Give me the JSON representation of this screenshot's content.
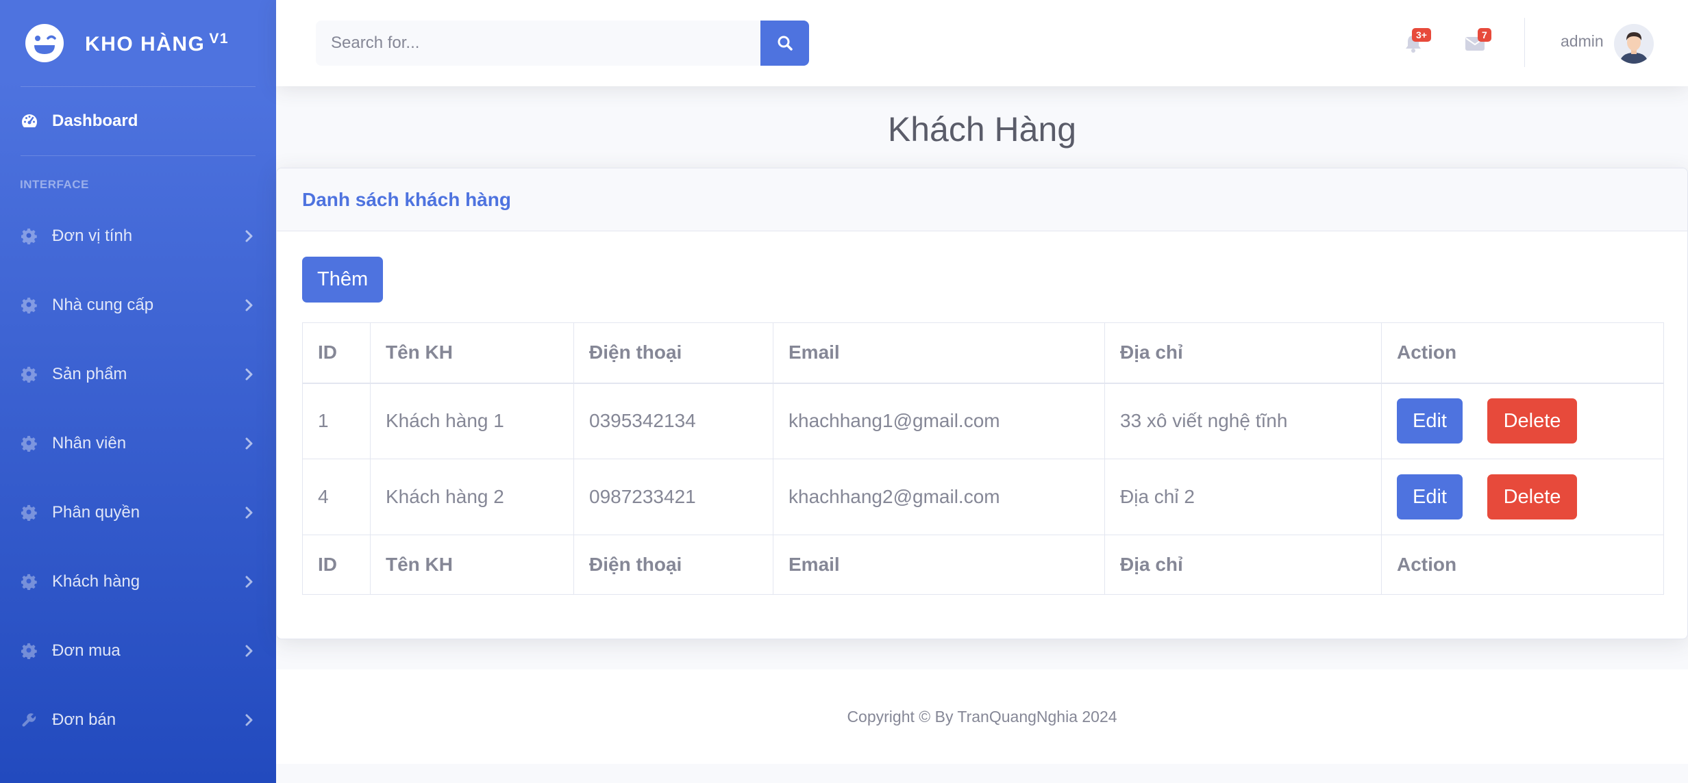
{
  "brand": {
    "name": "KHO HÀNG",
    "version": "V1"
  },
  "sidebar": {
    "dashboard": "Dashboard",
    "heading": "INTERFACE",
    "items": [
      {
        "label": "Đơn vị tính",
        "icon": "cog-icon"
      },
      {
        "label": "Nhà cung cấp",
        "icon": "cog-icon"
      },
      {
        "label": "Sản phẩm",
        "icon": "cog-icon"
      },
      {
        "label": "Nhân viên",
        "icon": "cog-icon"
      },
      {
        "label": "Phân quyền",
        "icon": "cog-icon"
      },
      {
        "label": "Khách hàng",
        "icon": "cog-icon"
      },
      {
        "label": "Đơn mua",
        "icon": "cog-icon"
      },
      {
        "label": "Đơn bán",
        "icon": "wrench-icon"
      }
    ]
  },
  "topbar": {
    "search_placeholder": "Search for...",
    "alerts_count": "3+",
    "messages_count": "7",
    "user_name": "admin"
  },
  "page": {
    "title": "Khách Hàng"
  },
  "card": {
    "header": "Danh sách khách hàng",
    "add_label": "Thêm"
  },
  "table": {
    "columns": [
      "ID",
      "Tên KH",
      "Điện thoại",
      "Email",
      "Địa chỉ",
      "Action"
    ],
    "rows": [
      {
        "id": "1",
        "name": "Khách hàng 1",
        "phone": "0395342134",
        "email": "khachhang1@gmail.com",
        "address": "33 xô viết nghệ tĩnh"
      },
      {
        "id": "4",
        "name": "Khách hàng 2",
        "phone": "0987233421",
        "email": "khachhang2@gmail.com",
        "address": "Địa chỉ 2"
      }
    ],
    "edit_label": "Edit",
    "delete_label": "Delete"
  },
  "footer": {
    "copyright": "Copyright © By TranQuangNghia 2024"
  },
  "colors": {
    "primary": "#4e73df",
    "danger": "#e74a3b",
    "text": "#858796"
  }
}
